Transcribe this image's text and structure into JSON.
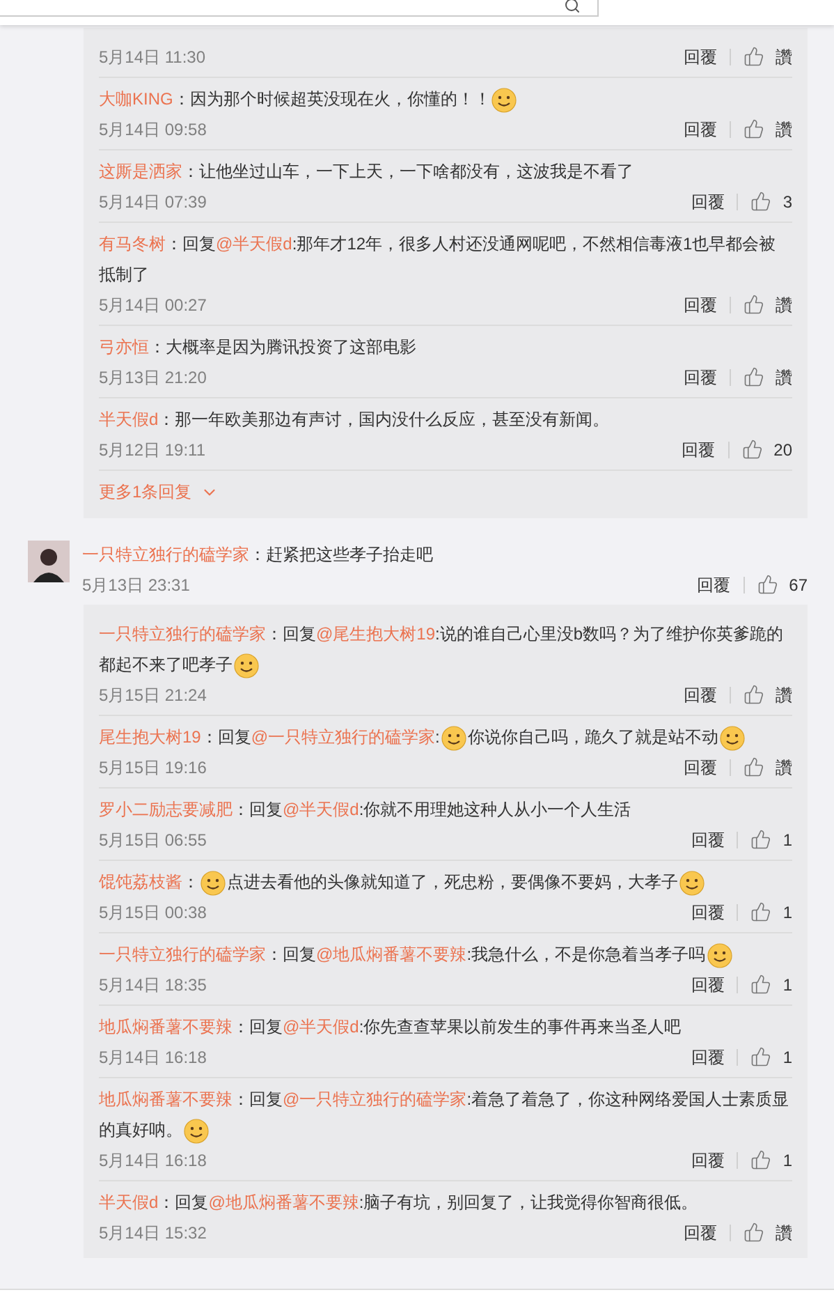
{
  "threads": [
    {
      "replies": [
        {
          "date": "5月14日 11:30",
          "reply": "回覆",
          "likes": "讚"
        },
        {
          "name": "大咖KING",
          "content": [
            {
              "kind": "text",
              "text": "：因为那个时候超英没现在火，你懂的！！"
            },
            {
              "kind": "emoji"
            }
          ],
          "date": "5月14日 09:58",
          "reply": "回覆",
          "likes": "讚"
        },
        {
          "name": "这厮是洒家",
          "content": [
            {
              "kind": "text",
              "text": "：让他坐过山车，一下上天，一下啥都没有，这波我是不看了"
            }
          ],
          "date": "5月14日 07:39",
          "reply": "回覆",
          "likes": "3"
        },
        {
          "name": "有马冬树",
          "content": [
            {
              "kind": "text",
              "text": "：回复"
            },
            {
              "kind": "mention",
              "text": "@半天假d"
            },
            {
              "kind": "text",
              "text": ":那年才12年，很多人村还没通网呢吧，不然相信毒液1也早都会被抵制了"
            }
          ],
          "date": "5月14日 00:27",
          "reply": "回覆",
          "likes": "讚"
        },
        {
          "name": "弓亦恒",
          "content": [
            {
              "kind": "text",
              "text": "：大概率是因为腾讯投资了这部电影"
            }
          ],
          "date": "5月13日 21:20",
          "reply": "回覆",
          "likes": "讚"
        },
        {
          "name": "半天假d",
          "content": [
            {
              "kind": "text",
              "text": "：那一年欧美那边有声讨，国内没什么反应，甚至没有新闻。"
            }
          ],
          "date": "5月12日 19:11",
          "reply": "回覆",
          "likes": "20"
        }
      ],
      "more": "更多1条回复"
    },
    {
      "main": {
        "name": "一只特立独行的磕学家",
        "content": [
          {
            "kind": "text",
            "text": "：赶紧把这些孝子抬走吧"
          }
        ],
        "date": "5月13日 23:31",
        "reply": "回覆",
        "likes": "67"
      },
      "replies": [
        {
          "name": "一只特立独行的磕学家",
          "content": [
            {
              "kind": "text",
              "text": "：回复"
            },
            {
              "kind": "mention",
              "text": "@尾生抱大树19"
            },
            {
              "kind": "text",
              "text": ":说的谁自己心里没b数吗？为了维护你英爹跪的都起不来了吧孝子"
            },
            {
              "kind": "emoji"
            }
          ],
          "date": "5月15日 21:24",
          "reply": "回覆",
          "likes": "讚"
        },
        {
          "name": "尾生抱大树19",
          "content": [
            {
              "kind": "text",
              "text": "：回复"
            },
            {
              "kind": "mention",
              "text": "@一只特立独行的磕学家"
            },
            {
              "kind": "text",
              "text": ":"
            },
            {
              "kind": "emoji"
            },
            {
              "kind": "text",
              "text": "你说你自己吗，跪久了就是站不动"
            },
            {
              "kind": "emoji"
            }
          ],
          "date": "5月15日 19:16",
          "reply": "回覆",
          "likes": "讚"
        },
        {
          "name": "罗小二励志要减肥",
          "content": [
            {
              "kind": "text",
              "text": "：回复"
            },
            {
              "kind": "mention",
              "text": "@半天假d"
            },
            {
              "kind": "text",
              "text": ":你就不用理她这种人从小一个人生活"
            }
          ],
          "date": "5月15日 06:55",
          "reply": "回覆",
          "likes": "1"
        },
        {
          "name": "馄饨荔枝酱",
          "content": [
            {
              "kind": "text",
              "text": "："
            },
            {
              "kind": "emoji"
            },
            {
              "kind": "text",
              "text": "点进去看他的头像就知道了，死忠粉，要偶像不要妈，大孝子"
            },
            {
              "kind": "emoji"
            }
          ],
          "date": "5月15日 00:38",
          "reply": "回覆",
          "likes": "1"
        },
        {
          "name": "一只特立独行的磕学家",
          "content": [
            {
              "kind": "text",
              "text": "：回复"
            },
            {
              "kind": "mention",
              "text": "@地瓜焖番薯不要辣"
            },
            {
              "kind": "text",
              "text": ":我急什么，不是你急着当孝子吗"
            },
            {
              "kind": "emoji"
            }
          ],
          "date": "5月14日 18:35",
          "reply": "回覆",
          "likes": "1"
        },
        {
          "name": "地瓜焖番薯不要辣",
          "content": [
            {
              "kind": "text",
              "text": "：回复"
            },
            {
              "kind": "mention",
              "text": "@半天假d"
            },
            {
              "kind": "text",
              "text": ":你先查查苹果以前发生的事件再来当圣人吧"
            }
          ],
          "date": "5月14日 16:18",
          "reply": "回覆",
          "likes": "1"
        },
        {
          "name": "地瓜焖番薯不要辣",
          "content": [
            {
              "kind": "text",
              "text": "：回复"
            },
            {
              "kind": "mention",
              "text": "@一只特立独行的磕学家"
            },
            {
              "kind": "text",
              "text": ":着急了着急了，你这种网络爱国人士素质显的真好呐。"
            },
            {
              "kind": "emoji"
            }
          ],
          "date": "5月14日 16:18",
          "reply": "回覆",
          "likes": "1"
        },
        {
          "name": "半天假d",
          "content": [
            {
              "kind": "text",
              "text": "：回复"
            },
            {
              "kind": "mention",
              "text": "@地瓜焖番薯不要辣"
            },
            {
              "kind": "text",
              "text": ":脑子有坑，别回复了，让我觉得你智商很低。"
            }
          ],
          "date": "5月14日 15:32",
          "reply": "回覆",
          "likes": "讚"
        }
      ]
    }
  ]
}
